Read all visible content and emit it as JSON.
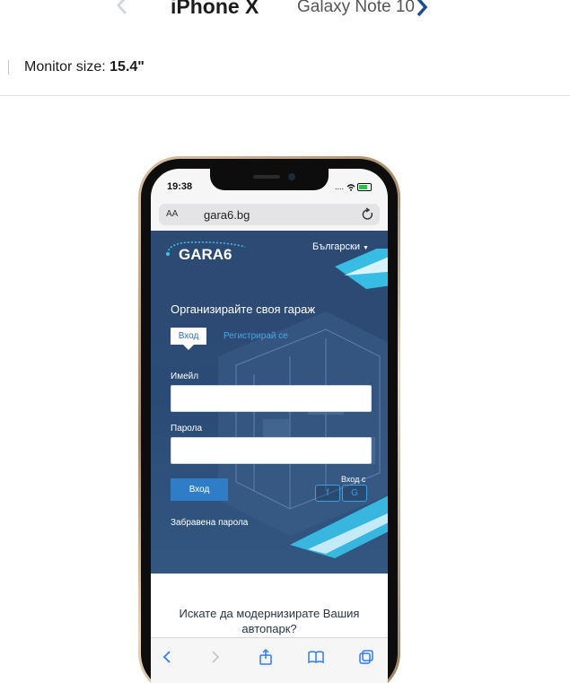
{
  "device_switcher": {
    "current": "iPhone X",
    "next": "Galaxy Note 10"
  },
  "monitor": {
    "label": "Monitor size:",
    "value": "15.4\""
  },
  "phone": {
    "status_time": "19:38",
    "status_signal": "....",
    "address_bar": {
      "text_size_label": "AA",
      "url": "gara6.bg"
    },
    "site": {
      "logo_text": "GARA6",
      "language": "Български",
      "headline": "Организирайте своя гараж",
      "tab_login": "Вход",
      "tab_register": "Регистрирай се",
      "email_label": "Имейл",
      "email_value": "",
      "password_label": "Парола",
      "password_value": "",
      "login_button": "Вход",
      "social_label": "Вход с",
      "social_facebook": "f",
      "social_google": "G",
      "forgot_password": "Забравена парола",
      "teaser": "Искате да модернизирате Вашия автопарк?"
    }
  },
  "colors": {
    "site_bg": "#2d4a73",
    "accent_blue": "#2f7cc7",
    "link_blue": "#4aa7e8",
    "phone_frame": "#c9ad8a"
  }
}
